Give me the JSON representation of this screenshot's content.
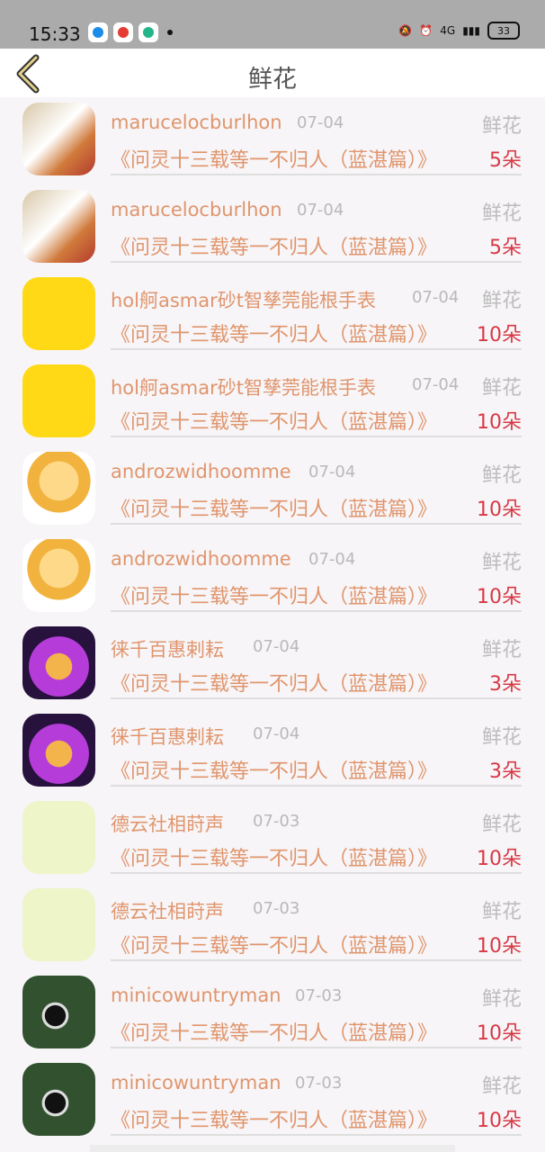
{
  "status_bar": {
    "time": "15:33",
    "battery": "33",
    "network": "4G"
  },
  "header": {
    "title": "鲜花"
  },
  "rows": [
    {
      "name": "marucelocburlhon",
      "date": "07-04",
      "gift": "鲜花",
      "book": "《问灵十三载等一不归人（蓝湛篇）》",
      "count": "5朵",
      "avatar": "photo-avatar"
    },
    {
      "name": "marucelocburlhon",
      "date": "07-04",
      "gift": "鲜花",
      "book": "《问灵十三载等一不归人（蓝湛篇）》",
      "count": "5朵",
      "avatar": "photo-avatar"
    },
    {
      "name": "hol舸asmar砂t智孳莞能根手表",
      "date": "07-04",
      "gift": "鲜花",
      "book": "《问灵十三载等一不归人（蓝湛篇）》",
      "count": "10朵",
      "avatar": "sketch-avatar"
    },
    {
      "name": "hol舸asmar砂t智孳莞能根手表",
      "date": "07-04",
      "gift": "鲜花",
      "book": "《问灵十三载等一不归人（蓝湛篇）》",
      "count": "10朵",
      "avatar": "sketch-avatar"
    },
    {
      "name": "androzwidhoomme",
      "date": "07-04",
      "gift": "鲜花",
      "book": "《问灵十三载等一不归人（蓝湛篇）》",
      "count": "10朵",
      "avatar": "food-avatar"
    },
    {
      "name": "androzwidhoomme",
      "date": "07-04",
      "gift": "鲜花",
      "book": "《问灵十三载等一不归人（蓝湛篇）》",
      "count": "10朵",
      "avatar": "food-avatar"
    },
    {
      "name": "徕千百惠剌耘",
      "date": "07-04",
      "gift": "鲜花",
      "book": "《问灵十三载等一不归人（蓝湛篇）》",
      "count": "3朵",
      "avatar": "buddha-avatar"
    },
    {
      "name": "徕千百惠剌耘",
      "date": "07-04",
      "gift": "鲜花",
      "book": "《问灵十三载等一不归人（蓝湛篇）》",
      "count": "3朵",
      "avatar": "buddha-avatar"
    },
    {
      "name": "德云社相莳声",
      "date": "07-03",
      "gift": "鲜花",
      "book": "《问灵十三载等一不归人（蓝湛篇）》",
      "count": "10朵",
      "avatar": "cartoon-avatar"
    },
    {
      "name": "德云社相莳声",
      "date": "07-03",
      "gift": "鲜花",
      "book": "《问灵十三载等一不归人（蓝湛篇）》",
      "count": "10朵",
      "avatar": "cartoon-avatar"
    },
    {
      "name": "minicowuntryman",
      "date": "07-03",
      "gift": "鲜花",
      "book": "《问灵十三载等一不归人（蓝湛篇）》",
      "count": "10朵",
      "avatar": "runner-avatar"
    },
    {
      "name": "minicowuntryman",
      "date": "07-03",
      "gift": "鲜花",
      "book": "《问灵十三载等一不归人（蓝湛篇）》",
      "count": "10朵",
      "avatar": "runner-avatar"
    }
  ]
}
